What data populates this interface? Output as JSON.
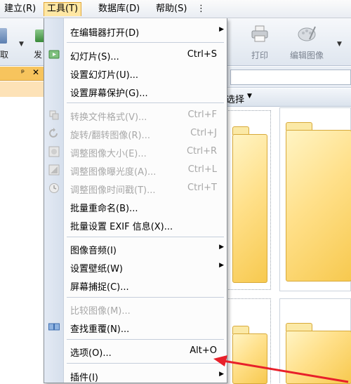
{
  "menubar": {
    "items": [
      {
        "label": "建立(R)"
      },
      {
        "label": "工具(T)"
      },
      {
        "label": "数据库(D)"
      },
      {
        "label": "帮助(S)"
      }
    ],
    "more": "⋮"
  },
  "toolbar": {
    "left_partial_1": "取",
    "left_partial_2": "发",
    "print_label": "打印",
    "edit_label": "编辑图像",
    "print_icon": "printer-icon",
    "edit_icon": "palette-icon"
  },
  "left_panel": {
    "pin_icon": "pin-icon",
    "close_icon": "close-icon"
  },
  "content": {
    "filter_label": "选择"
  },
  "tools_menu": {
    "items": [
      {
        "label": "在编辑器打开(D)",
        "shortcut": "",
        "submenu": true,
        "disabled": false
      },
      {
        "label": "幻灯片(S)...",
        "shortcut": "Ctrl+S",
        "submenu": false,
        "disabled": false,
        "icon": "slideshow-icon"
      },
      {
        "label": "设置幻灯片(U)...",
        "shortcut": "",
        "submenu": false,
        "disabled": false
      },
      {
        "label": "设置屏幕保护(G)...",
        "shortcut": "",
        "submenu": false,
        "disabled": false
      },
      {
        "label": "转换文件格式(V)...",
        "shortcut": "Ctrl+F",
        "submenu": false,
        "disabled": true,
        "icon": "convert-icon"
      },
      {
        "label": "旋转/翻转图像(R)...",
        "shortcut": "Ctrl+J",
        "submenu": false,
        "disabled": true,
        "icon": "rotate-icon"
      },
      {
        "label": "调整图像大小(E)...",
        "shortcut": "Ctrl+R",
        "submenu": false,
        "disabled": true,
        "icon": "resize-icon"
      },
      {
        "label": "调整图像曝光度(A)...",
        "shortcut": "Ctrl+L",
        "submenu": false,
        "disabled": true,
        "icon": "exposure-icon"
      },
      {
        "label": "调整图像时间戳(T)...",
        "shortcut": "Ctrl+T",
        "submenu": false,
        "disabled": true,
        "icon": "timestamp-icon"
      },
      {
        "label": "批量重命名(B)...",
        "shortcut": "",
        "submenu": false,
        "disabled": false
      },
      {
        "label": "批量设置 EXIF 信息(X)...",
        "shortcut": "",
        "submenu": false,
        "disabled": false
      },
      {
        "label": "图像音频(I)",
        "shortcut": "",
        "submenu": true,
        "disabled": false
      },
      {
        "label": "设置壁纸(W)",
        "shortcut": "",
        "submenu": true,
        "disabled": false
      },
      {
        "label": "屏幕捕捉(C)...",
        "shortcut": "",
        "submenu": false,
        "disabled": false
      },
      {
        "label": "比较图像(M)...",
        "shortcut": "",
        "submenu": false,
        "disabled": true
      },
      {
        "label": "查找重覆(N)...",
        "shortcut": "",
        "submenu": false,
        "disabled": false,
        "icon": "find-duplicates-icon"
      },
      {
        "label": "选项(O)...",
        "shortcut": "Alt+O",
        "submenu": false,
        "disabled": false
      },
      {
        "label": "插件(I)",
        "shortcut": "",
        "submenu": true,
        "disabled": false
      }
    ]
  },
  "colors": {
    "menu_highlight": "#ffe7a3",
    "panel_header": "#f7c45d",
    "annotation_arrow": "#e8202a",
    "folder": "#ffe08a"
  }
}
